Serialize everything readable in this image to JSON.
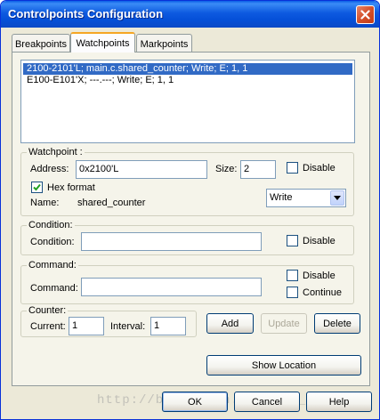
{
  "window": {
    "title": "Controlpoints Configuration"
  },
  "tabs": [
    {
      "label": "Breakpoints",
      "active": false
    },
    {
      "label": "Watchpoints",
      "active": true
    },
    {
      "label": "Markpoints",
      "active": false
    }
  ],
  "watch_list": [
    {
      "text": "2100-2101'L; main.c.shared_counter; Write; E; 1, 1",
      "selected": true
    },
    {
      "text": "E100-E101'X; ---.---; Write; E; 1, 1",
      "selected": false
    }
  ],
  "watchpoint": {
    "group_label": "Watchpoint :",
    "address_label": "Address:",
    "address_value": "0x2100'L",
    "size_label": "Size:",
    "size_value": "2",
    "disable_label": "Disable",
    "disable_checked": false,
    "hex_format_label": "Hex format",
    "hex_format_checked": true,
    "name_label": "Name:",
    "name_value": "shared_counter",
    "access_value": "Write"
  },
  "condition": {
    "group_label": "Condition:",
    "condition_label": "Condition:",
    "condition_value": "",
    "disable_label": "Disable",
    "disable_checked": false
  },
  "command": {
    "group_label": "Command:",
    "command_label": "Command:",
    "command_value": "",
    "disable_label": "Disable",
    "disable_checked": false,
    "continue_label": "Continue",
    "continue_checked": false
  },
  "counter": {
    "group_label": "Counter:",
    "current_label": "Current:",
    "current_value": "1",
    "interval_label": "Interval:",
    "interval_value": "1"
  },
  "actions": {
    "add_label": "Add",
    "update_label": "Update",
    "delete_label": "Delete",
    "show_location_label": "Show Location"
  },
  "footer": {
    "ok_label": "OK",
    "cancel_label": "Cancel",
    "help_label": "Help"
  },
  "watermark": "http://blog.csdn.net/lin_strong",
  "colors": {
    "title_bar": "#0a5fe6",
    "selection": "#316ac5",
    "window_bg": "#ece9d8",
    "close_button": "#d4502a"
  }
}
